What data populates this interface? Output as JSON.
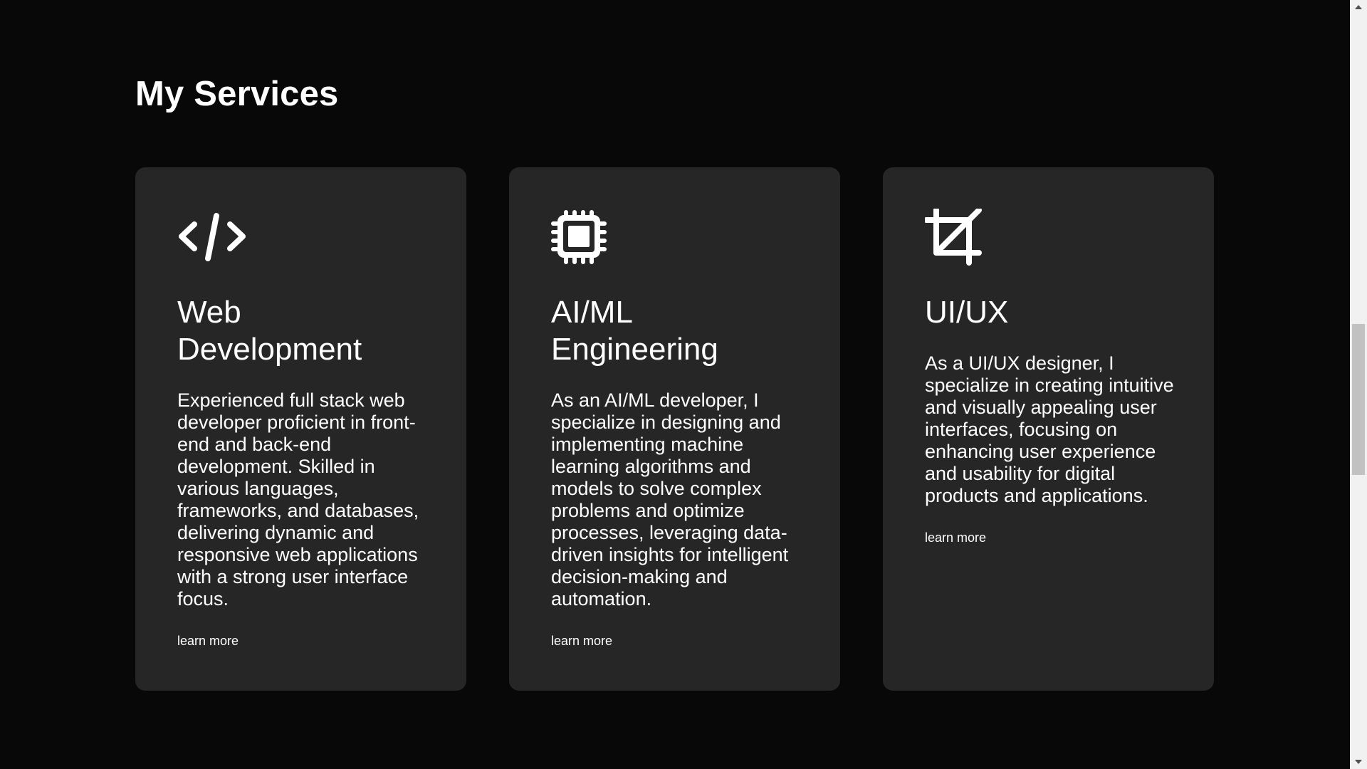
{
  "section": {
    "title": "My Services"
  },
  "cards": [
    {
      "icon": "code-icon",
      "title_line1": "Web",
      "title_line2": "Development",
      "description": "Experienced full stack web developer proficient in front-end and back-end development. Skilled in various languages, frameworks, and databases, delivering dynamic and responsive web applications with a strong user interface focus.",
      "link": "learn more"
    },
    {
      "icon": "chip-icon",
      "title_line1": "AI/ML",
      "title_line2": "Engineering",
      "description": "As an AI/ML developer, I specialize in designing and implementing machine learning algorithms and models to solve complex problems and optimize processes, leveraging data-driven insights for intelligent decision-making and automation.",
      "link": "learn more"
    },
    {
      "icon": "crop-icon",
      "title_line1": "UI/UX",
      "title_line2": "",
      "description": "As a UI/UX designer, I specialize in creating intuitive and visually appealing user interfaces, focusing on enhancing user experience and usability for digital products and applications.",
      "link": "learn more"
    }
  ],
  "colors": {
    "background": "#080808",
    "card": "#262626",
    "text": "#ffffff"
  }
}
